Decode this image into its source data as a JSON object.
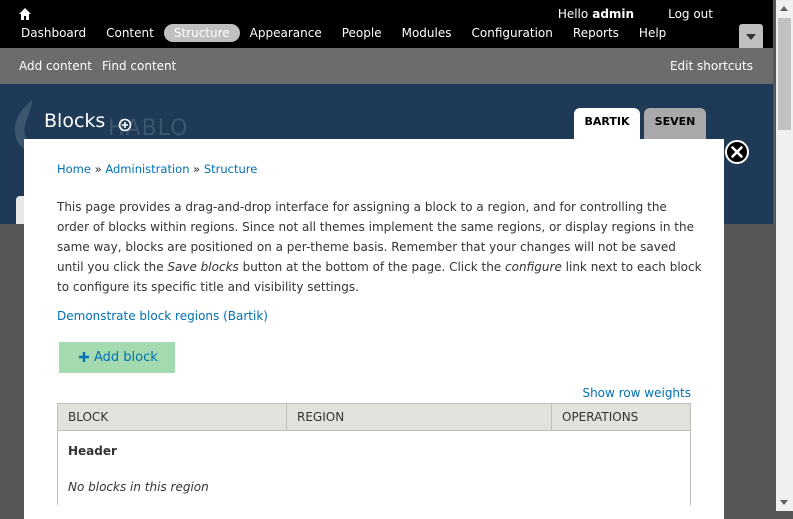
{
  "toolbar": {
    "hello": "Hello",
    "username": "admin",
    "logout": "Log out",
    "menu": [
      "Dashboard",
      "Content",
      "Structure",
      "Appearance",
      "People",
      "Modules",
      "Configuration",
      "Reports",
      "Help"
    ],
    "active_menu": "Structure"
  },
  "shortcuts": {
    "items": [
      "Add content",
      "Find content"
    ],
    "edit": "Edit shortcuts"
  },
  "header": {
    "title": "Blocks",
    "logo_text": "HABLO",
    "tabs": [
      {
        "label": "BARTIK",
        "active": true
      },
      {
        "label": "SEVEN",
        "active": false
      }
    ]
  },
  "breadcrumb": [
    "Home",
    "Administration",
    "Structure"
  ],
  "description": {
    "part1": "This page provides a drag-and-drop interface for assigning a block to a region, and for controlling the order of blocks within regions. Since not all themes implement the same regions, or display regions in the same way, blocks are positioned on a per-theme basis. Remember that your changes will not be saved until you click the ",
    "em1": "Save blocks",
    "part2": " button at the bottom of the page. Click the ",
    "em2": "configure",
    "part3": " link next to each block to configure its specific title and visibility settings."
  },
  "demo_link": "Demonstrate block regions (Bartik)",
  "add_block": "Add block",
  "show_row_weights": "Show row weights",
  "table": {
    "headers": [
      "Block",
      "Region",
      "Operations"
    ],
    "region": "Header",
    "empty_text": "No blocks in this region"
  },
  "colors": {
    "toolbar_bg": "#000000",
    "shortcut_bg": "#6c6c6c",
    "header_bg": "#1f3a56",
    "link": "#0071b3",
    "add_block_bg": "#a4dab0"
  }
}
